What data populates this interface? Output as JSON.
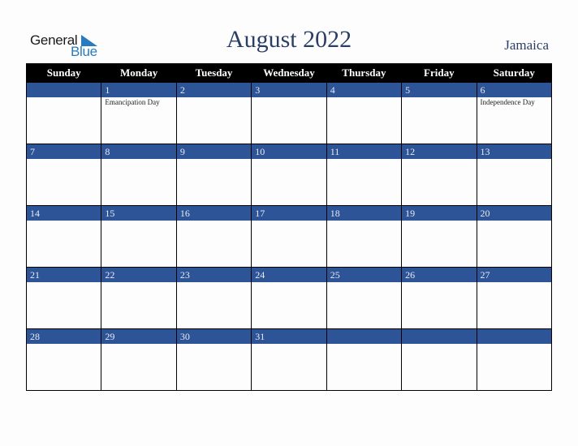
{
  "brand": {
    "line1": "General",
    "line2": "Blue",
    "accent_color": "#2a7bbd",
    "icon": "triangle-flag-icon"
  },
  "header": {
    "title": "August 2022",
    "country": "Jamaica"
  },
  "colors": {
    "weekday_header_bg": "#000000",
    "date_bar_bg": "#2d5496",
    "title_color": "#2b3f66"
  },
  "weekdays": [
    "Sunday",
    "Monday",
    "Tuesday",
    "Wednesday",
    "Thursday",
    "Friday",
    "Saturday"
  ],
  "weeks": [
    [
      {
        "day": "",
        "holiday": ""
      },
      {
        "day": "1",
        "holiday": "Emancipation Day"
      },
      {
        "day": "2",
        "holiday": ""
      },
      {
        "day": "3",
        "holiday": ""
      },
      {
        "day": "4",
        "holiday": ""
      },
      {
        "day": "5",
        "holiday": ""
      },
      {
        "day": "6",
        "holiday": "Independence Day"
      }
    ],
    [
      {
        "day": "7",
        "holiday": ""
      },
      {
        "day": "8",
        "holiday": ""
      },
      {
        "day": "9",
        "holiday": ""
      },
      {
        "day": "10",
        "holiday": ""
      },
      {
        "day": "11",
        "holiday": ""
      },
      {
        "day": "12",
        "holiday": ""
      },
      {
        "day": "13",
        "holiday": ""
      }
    ],
    [
      {
        "day": "14",
        "holiday": ""
      },
      {
        "day": "15",
        "holiday": ""
      },
      {
        "day": "16",
        "holiday": ""
      },
      {
        "day": "17",
        "holiday": ""
      },
      {
        "day": "18",
        "holiday": ""
      },
      {
        "day": "19",
        "holiday": ""
      },
      {
        "day": "20",
        "holiday": ""
      }
    ],
    [
      {
        "day": "21",
        "holiday": ""
      },
      {
        "day": "22",
        "holiday": ""
      },
      {
        "day": "23",
        "holiday": ""
      },
      {
        "day": "24",
        "holiday": ""
      },
      {
        "day": "25",
        "holiday": ""
      },
      {
        "day": "26",
        "holiday": ""
      },
      {
        "day": "27",
        "holiday": ""
      }
    ],
    [
      {
        "day": "28",
        "holiday": ""
      },
      {
        "day": "29",
        "holiday": ""
      },
      {
        "day": "30",
        "holiday": ""
      },
      {
        "day": "31",
        "holiday": ""
      },
      {
        "day": "",
        "holiday": ""
      },
      {
        "day": "",
        "holiday": ""
      },
      {
        "day": "",
        "holiday": ""
      }
    ]
  ]
}
